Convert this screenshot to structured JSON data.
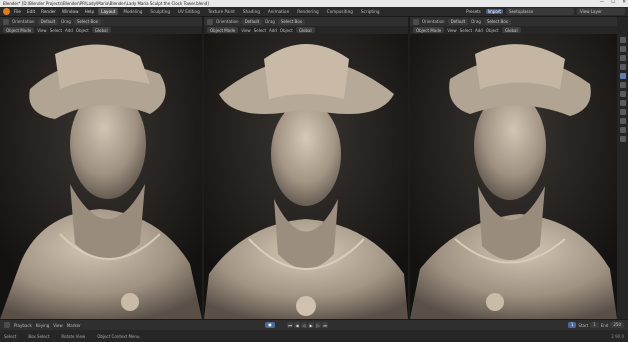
{
  "window": {
    "title": "Blender* [D:\\Blender Projects\\Blender\\PR\\Lady\\Maria\\Blender\\Lady Maria Sculpt the Clock Tower.blend]",
    "controls": [
      "—",
      "☐",
      "✕"
    ]
  },
  "menu": [
    "File",
    "Edit",
    "Render",
    "Window",
    "Help"
  ],
  "workspace_tabs": [
    "Layout",
    "Modeling",
    "Sculpting",
    "UV Editing",
    "Texture Paint",
    "Shading",
    "Animation",
    "Rendering",
    "Compositing",
    "Scripting"
  ],
  "active_workspace": "Layout",
  "topbar_right": {
    "tabs": [
      "Presets",
      "Import"
    ],
    "scene": "Sextoplasse",
    "view_layer": "View Layer"
  },
  "viewports": [
    {
      "orientation_label": "Orientation",
      "orientation_value": "Default",
      "drag": "Drag",
      "drag_value": "Select Box",
      "mode": "Object Mode",
      "menus": [
        "View",
        "Select",
        "Add",
        "Object"
      ],
      "transform": "Global"
    },
    {
      "orientation_label": "Orientation",
      "orientation_value": "Default",
      "drag": "Drag",
      "drag_value": "Select Box",
      "mode": "Object Mode",
      "menus": [
        "View",
        "Select",
        "Add",
        "Object"
      ],
      "transform": "Global"
    },
    {
      "orientation_label": "Orientation",
      "orientation_value": "Default",
      "drag": "Drag",
      "drag_value": "Select Box",
      "mode": "Object Mode",
      "menus": [
        "View",
        "Select",
        "Add",
        "Object"
      ],
      "transform": "Global"
    }
  ],
  "timeline": {
    "items": [
      "Playback",
      "Keying",
      "View",
      "Marker"
    ],
    "current_frame": "1",
    "start_label": "Start",
    "start": "1",
    "end_label": "End",
    "end": "250"
  },
  "statusbar": {
    "items": [
      "Select",
      "Box Select",
      "Rotate View",
      "Object Context Menu"
    ],
    "version": "2.90.0"
  },
  "colors": {
    "accent": "#4d6b9a",
    "logo": "#e87d0d",
    "clay": "#b8aa98"
  }
}
